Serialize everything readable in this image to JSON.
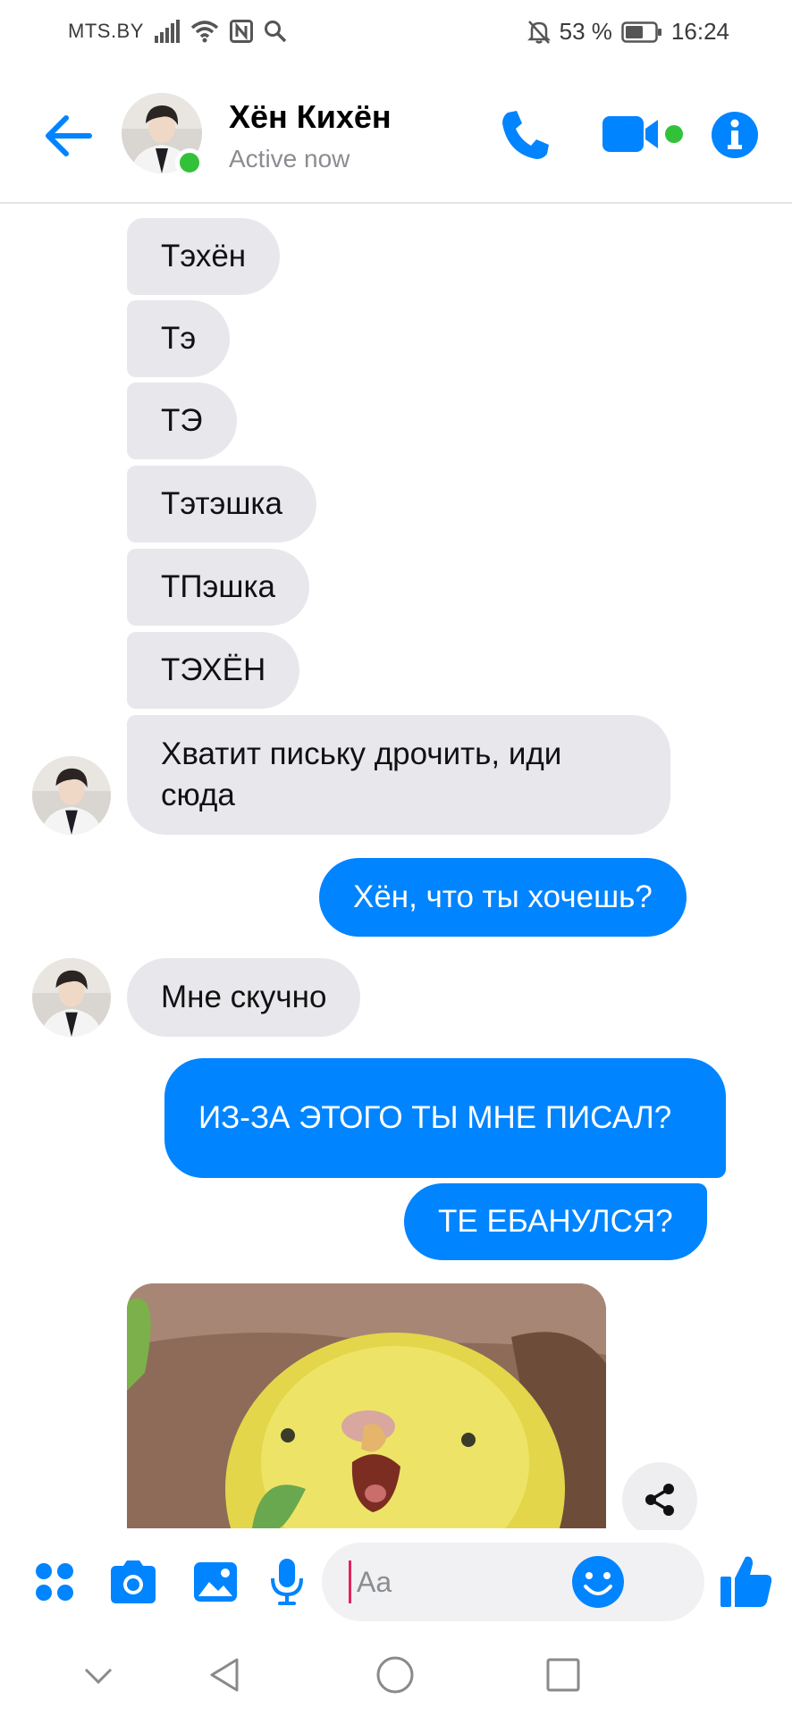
{
  "status_bar": {
    "carrier": "MTS.BY",
    "battery": "53 %",
    "time": "16:24"
  },
  "header": {
    "name": "Хён Кихён",
    "status": "Active now"
  },
  "messages": [
    {
      "dir": "in",
      "text": "Тэхён"
    },
    {
      "dir": "in",
      "text": "Тэ"
    },
    {
      "dir": "in",
      "text": "ТЭ"
    },
    {
      "dir": "in",
      "text": "Тэтэшка"
    },
    {
      "dir": "in",
      "text": "ТПэшка"
    },
    {
      "dir": "in",
      "text": "ТЭХЁН"
    },
    {
      "dir": "in",
      "text": "Хватит письку дрочить, иди сюда"
    },
    {
      "dir": "out",
      "text": "Хён, что ты хочешь?"
    },
    {
      "dir": "in",
      "text": "Мне скучно"
    },
    {
      "dir": "out",
      "text": "ИЗ-ЗА ЭТОГО ТЫ МНЕ ПИСАЛ?"
    },
    {
      "dir": "out",
      "text": "ТЕ ЕБАНУЛСЯ?"
    }
  ],
  "composer": {
    "placeholder": "Aa"
  },
  "icons": {
    "back": "arrow-left-icon",
    "call": "phone-icon",
    "video": "video-camera-icon",
    "info": "info-icon",
    "apps": "four-dots-icon",
    "camera": "camera-icon",
    "gallery": "image-icon",
    "mic": "microphone-icon",
    "emoji": "smiley-icon",
    "like": "thumbs-up-icon",
    "share": "share-icon"
  },
  "colors": {
    "accent": "#0084ff",
    "incoming_bubble": "#e8e7ec",
    "online": "#31c23a"
  }
}
